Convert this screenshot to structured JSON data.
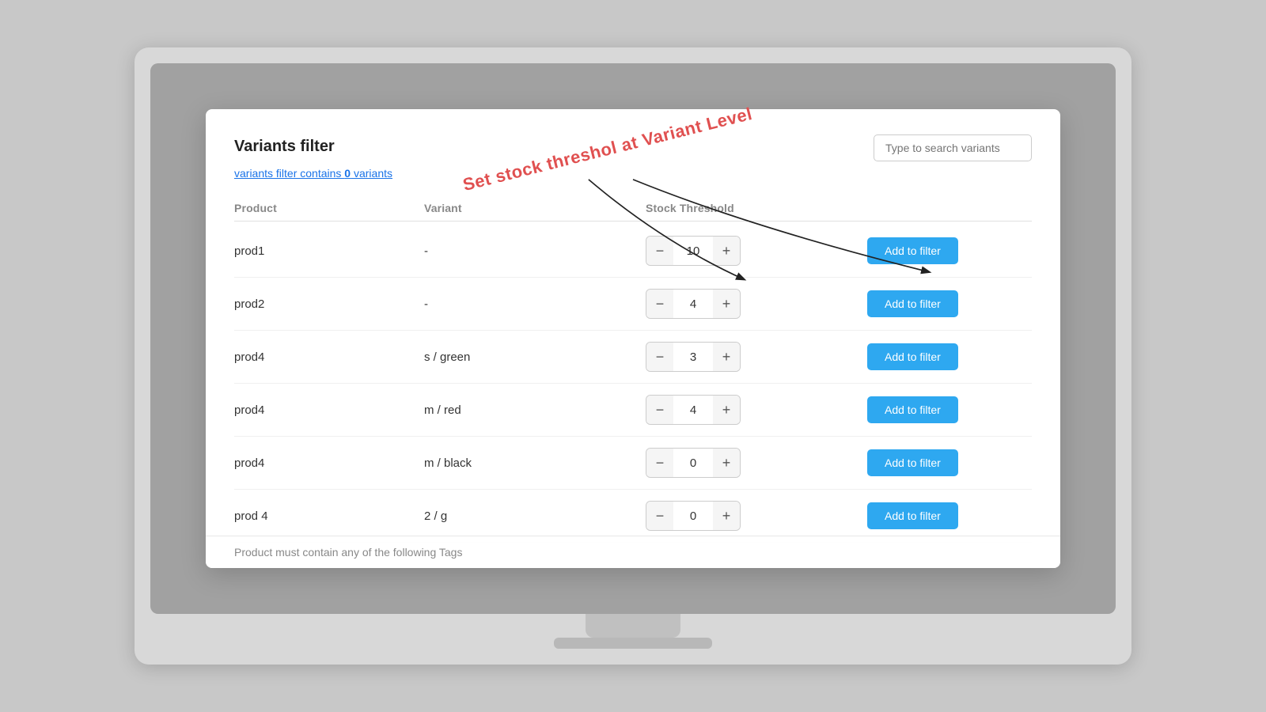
{
  "modal": {
    "title": "Variants filter",
    "close_label": "×",
    "filter_link_text": "variants filter contains ",
    "filter_count": "0",
    "filter_link_suffix": " variants",
    "search_placeholder": "Type to search variants",
    "annotation_text": "Set stock threshol at Variant Level",
    "bottom_text": "Product must contain any of the following Tags",
    "table": {
      "headers": [
        "Product",
        "Variant",
        "Stock Threshold",
        ""
      ],
      "rows": [
        {
          "product": "prod1",
          "variant": "-",
          "stock": 10,
          "btn": "Add to filter"
        },
        {
          "product": "prod2",
          "variant": "-",
          "stock": 4,
          "btn": "Add to filter"
        },
        {
          "product": "prod4",
          "variant": "s / green",
          "stock": 3,
          "btn": "Add to filter"
        },
        {
          "product": "prod4",
          "variant": "m / red",
          "stock": 4,
          "btn": "Add to filter"
        },
        {
          "product": "prod4",
          "variant": "m / black",
          "stock": 0,
          "btn": "Add to filter"
        },
        {
          "product": "prod 4",
          "variant": "2 / g",
          "stock": 0,
          "btn": "Add to filter"
        }
      ]
    }
  },
  "monitor": {
    "stand_visible": true
  }
}
